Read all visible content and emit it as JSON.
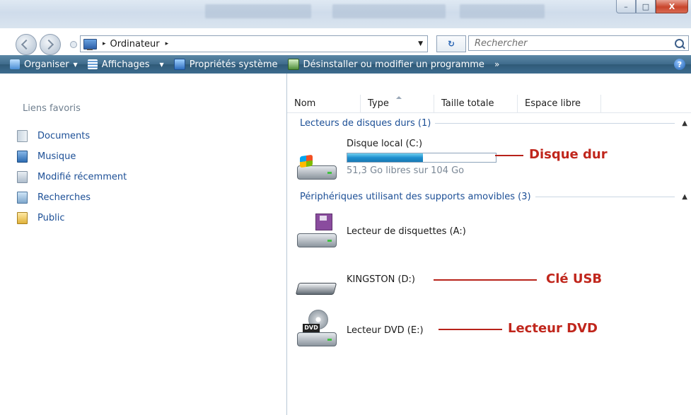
{
  "window": {
    "controls": {
      "minimize": "–",
      "maximize": "□",
      "close": "X"
    }
  },
  "nav": {
    "breadcrumb": "Ordinateur",
    "crumb_sep": "▸",
    "search_placeholder": "Rechercher"
  },
  "toolbar": {
    "organize": "Organiser",
    "views": "Affichages",
    "system_props": "Propriétés système",
    "uninstall": "Désinstaller ou modifier un programme",
    "more": "»",
    "help": "?"
  },
  "sidebar": {
    "title": "Liens favoris",
    "items": [
      {
        "label": "Documents",
        "icon": "documents-icon"
      },
      {
        "label": "Musique",
        "icon": "music-icon"
      },
      {
        "label": "Modifié récemment",
        "icon": "recent-icon"
      },
      {
        "label": "Recherches",
        "icon": "searches-icon"
      },
      {
        "label": "Public",
        "icon": "public-folder-icon"
      }
    ]
  },
  "columns": [
    "Nom",
    "Type",
    "Taille totale",
    "Espace libre"
  ],
  "groups": {
    "hdd": {
      "title": "Lecteurs de disques durs (1)"
    },
    "removable": {
      "title": "Périphériques utilisant des supports amovibles (3)"
    }
  },
  "drives": {
    "c": {
      "name": "Disque local (C:)",
      "free_text": "51,3 Go libres sur 104 Go",
      "used_fraction": 0.51
    },
    "a": {
      "name": "Lecteur de disquettes (A:)"
    },
    "d": {
      "name": "KINGSTON (D:)"
    },
    "e": {
      "name": "Lecteur DVD (E:)",
      "icon_label": "DVD"
    }
  },
  "annotations": {
    "hdd": "Disque dur",
    "usb": "Clé USB",
    "dvd": "Lecteur DVD"
  },
  "colors": {
    "annotation": "#c0261c",
    "toolbar": "#3f6b8c",
    "link": "#1c4f96"
  }
}
